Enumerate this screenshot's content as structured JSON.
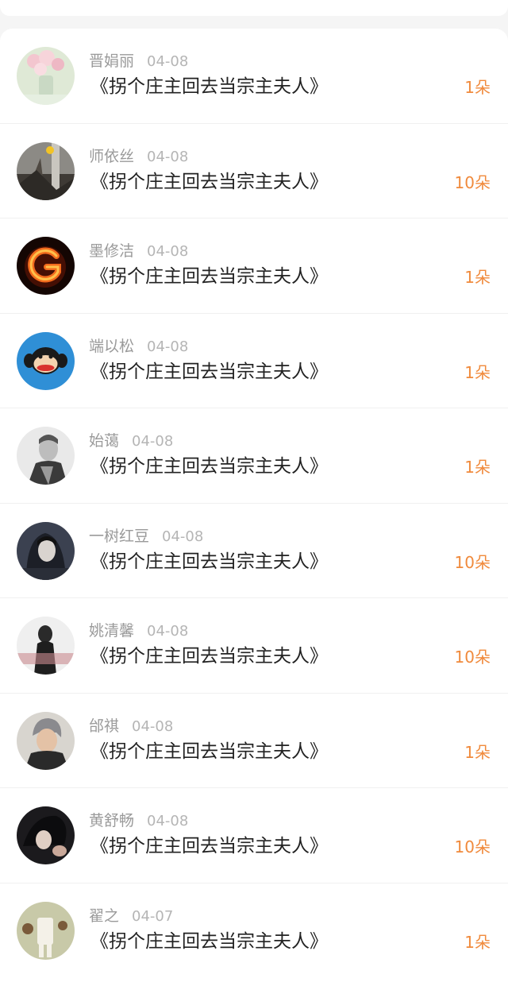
{
  "accent_color": "#f08a3c",
  "items": [
    {
      "name": "晋娟丽",
      "date": "04-08",
      "book": "《拐个庄主回去当宗主夫人》",
      "flowers": "1朵",
      "avatar": "flowers-photo-avatar"
    },
    {
      "name": "师依丝",
      "date": "04-08",
      "book": "《拐个庄主回去当宗主夫人》",
      "flowers": "10朵",
      "avatar": "tree-photo-avatar"
    },
    {
      "name": "墨修洁",
      "date": "04-08",
      "book": "《拐个庄主回去当宗主夫人》",
      "flowers": "1朵",
      "avatar": "fire-letter-g-avatar"
    },
    {
      "name": "端以松",
      "date": "04-08",
      "book": "《拐个庄主回去当宗主夫人》",
      "flowers": "1朵",
      "avatar": "monkey-avatar"
    },
    {
      "name": "始蔼",
      "date": "04-08",
      "book": "《拐个庄主回去当宗主夫人》",
      "flowers": "1朵",
      "avatar": "portrait-avatar"
    },
    {
      "name": "一树红豆",
      "date": "04-08",
      "book": "《拐个庄主回去当宗主夫人》",
      "flowers": "10朵",
      "avatar": "portrait-avatar"
    },
    {
      "name": "姚清馨",
      "date": "04-08",
      "book": "《拐个庄主回去当宗主夫人》",
      "flowers": "10朵",
      "avatar": "portrait-avatar"
    },
    {
      "name": "邰祺",
      "date": "04-08",
      "book": "《拐个庄主回去当宗主夫人》",
      "flowers": "1朵",
      "avatar": "portrait-avatar"
    },
    {
      "name": "黄舒畅",
      "date": "04-08",
      "book": "《拐个庄主回去当宗主夫人》",
      "flowers": "10朵",
      "avatar": "portrait-avatar"
    },
    {
      "name": "翟之",
      "date": "04-07",
      "book": "《拐个庄主回去当宗主夫人》",
      "flowers": "1朵",
      "avatar": "illustration-avatar"
    }
  ]
}
